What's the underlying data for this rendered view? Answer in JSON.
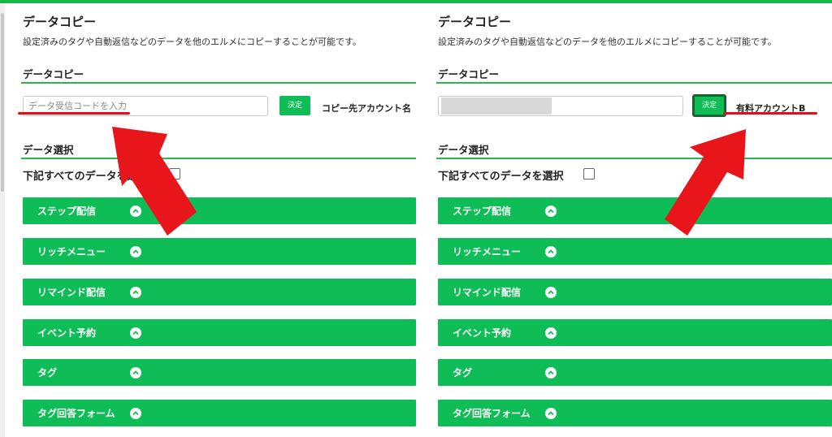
{
  "colors": {
    "accent": "#0fbd57",
    "annotation": "#e8161b",
    "topbar": "#14b84a"
  },
  "left": {
    "title": "データコピー",
    "description": "設定済みのタグや自動返信などのデータを他のエルメにコピーすることが可能です。",
    "copy_section_title": "データコピー",
    "code_input": {
      "placeholder": "データ受信コードを入力",
      "value": ""
    },
    "decide_label": "決定",
    "account_label": "コピー先アカウント名",
    "select_section_title": "データ選択",
    "select_all_label": "下記すべてのデータを選択",
    "sections": [
      {
        "label": "ステップ配信"
      },
      {
        "label": "リッチメニュー"
      },
      {
        "label": "リマインド配信"
      },
      {
        "label": "イベント予約"
      },
      {
        "label": "タグ"
      },
      {
        "label": "タグ回答フォーム"
      }
    ]
  },
  "right": {
    "title": "データコピー",
    "description": "設定済みのタグや自動返信などのデータを他のエルメにコピーすることが可能です。",
    "copy_section_title": "データコピー",
    "decide_label": "決定",
    "account_label": "有料アカウントB",
    "select_section_title": "データ選択",
    "select_all_label": "下記すべてのデータを選択",
    "sections": [
      {
        "label": "ステップ配信"
      },
      {
        "label": "リッチメニュー"
      },
      {
        "label": "リマインド配信"
      },
      {
        "label": "イベント予約"
      },
      {
        "label": "タグ"
      },
      {
        "label": "タグ回答フォーム"
      }
    ]
  },
  "icons": {
    "section_toggle": "chevron-up-icon",
    "annotation": "red-arrow-icon"
  }
}
